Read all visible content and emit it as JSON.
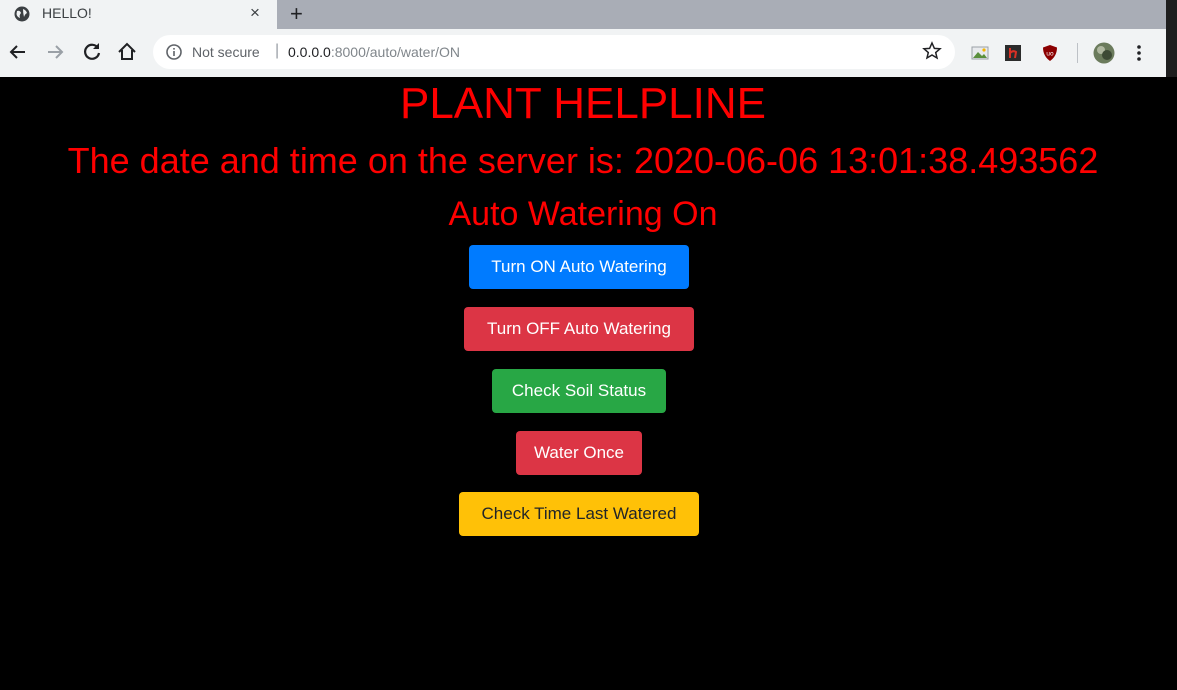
{
  "browser": {
    "tab_title": "HELLO!",
    "tab_close": "×",
    "new_tab": "+",
    "security_label": "Not secure",
    "url_host": "0.0.0.0",
    "url_path": ":8000/auto/water/ON"
  },
  "page": {
    "title": "PLANT HELPLINE",
    "datetime_text": "The date and time on the server is: 2020-06-06 13:01:38.493562",
    "status_text": "Auto Watering On",
    "buttons": {
      "auto_on": "Turn ON Auto Watering",
      "auto_off": "Turn OFF Auto Watering",
      "soil_status": "Check Soil Status",
      "water_once": "Water Once",
      "last_watered": "Check Time Last Watered"
    }
  },
  "colors": {
    "heading": "#ff0000",
    "primary": "#007bff",
    "danger": "#dc3545",
    "success": "#28a745",
    "warning": "#ffc107"
  }
}
